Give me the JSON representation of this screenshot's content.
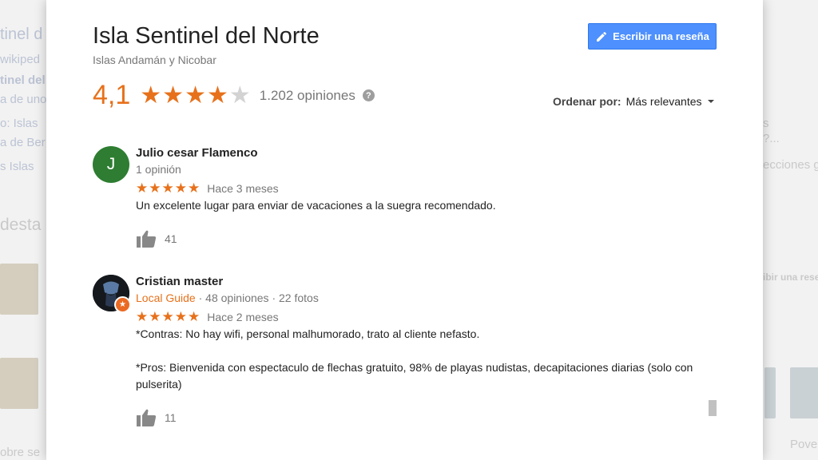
{
  "background": {
    "left_fragments": [
      "tinel d",
      "wikiped",
      "tinel del",
      "a de uno",
      "o: Islas",
      "a de Ber",
      "s   Islas",
      "desta",
      "obre se"
    ],
    "right_fragments": [
      "s",
      "?...",
      "ecciones g",
      "ibir una rese",
      "Pove"
    ]
  },
  "place": {
    "title": "Isla Sentinel del Norte",
    "subtitle": "Islas Andamán y Nicobar"
  },
  "write_review_button": {
    "label": "Escribir una reseña",
    "icon": "pencil-icon"
  },
  "summary": {
    "rating": "4,1",
    "stars_filled": 4,
    "stars_total": 5,
    "review_count": "1.202 opiniones",
    "help_icon": "?"
  },
  "sort": {
    "label": "Ordenar por:",
    "value": "Más relevantes"
  },
  "reviews": [
    {
      "avatar_letter": "J",
      "author": "Julio cesar Flamenco",
      "meta_plain": "1 opinión",
      "stars": "★★★★★",
      "time": "Hace 3 meses",
      "text": "Un excelente lugar para enviar de vacaciones a la suegra recomendado.",
      "likes": "41"
    },
    {
      "author": "Cristian master",
      "meta_guide": "Local Guide",
      "meta_rest": " · 48 opiniones · 22 fotos",
      "stars": "★★★★★",
      "time": "Hace 2 meses",
      "text": "*Contras: No hay wifi, personal malhumorado, trato al cliente nefasto.\n\n*Pros: Bienvenida con espectaculo de flechas gratuito, 98% de playas nudistas, decapitaciones diarias (solo con pulserita)",
      "likes": "11"
    }
  ],
  "colors": {
    "accent_orange": "#e7711b",
    "button_blue": "#4d90fe",
    "avatar_green": "#2e7d32"
  }
}
